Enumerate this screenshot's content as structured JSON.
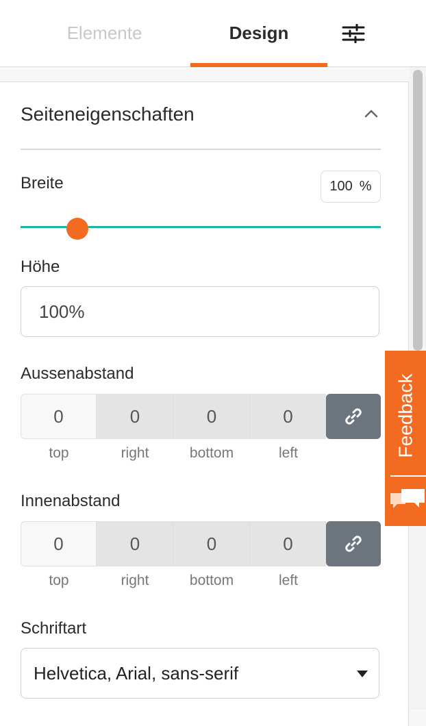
{
  "tabs": {
    "elemente": "Elemente",
    "design": "Design"
  },
  "icons": {
    "settings": "sliders-icon",
    "collapse": "chevron-up-icon",
    "link": "link-icon",
    "dropdown": "caret-down-icon",
    "feedback": "speech-bubbles-icon"
  },
  "colors": {
    "accent": "#f26b21",
    "slider_track": "#1bb5a4",
    "link_button": "#6c757d"
  },
  "section": {
    "title": "Seiteneigenschaften"
  },
  "breite": {
    "label": "Breite",
    "value": "100",
    "unit": "%",
    "slider_level": 0.1
  },
  "hoehe": {
    "label": "Höhe",
    "value": "100%"
  },
  "aussenabstand": {
    "label": "Aussenabstand",
    "values": [
      "0",
      "0",
      "0",
      "0"
    ],
    "sides": [
      "top",
      "right",
      "bottom",
      "left"
    ]
  },
  "innenabstand": {
    "label": "Innenabstand",
    "values": [
      "0",
      "0",
      "0",
      "0"
    ],
    "sides": [
      "top",
      "right",
      "bottom",
      "left"
    ]
  },
  "schriftart": {
    "label": "Schriftart",
    "value": "Helvetica, Arial, sans-serif"
  },
  "feedback": {
    "label": "Feedback"
  }
}
